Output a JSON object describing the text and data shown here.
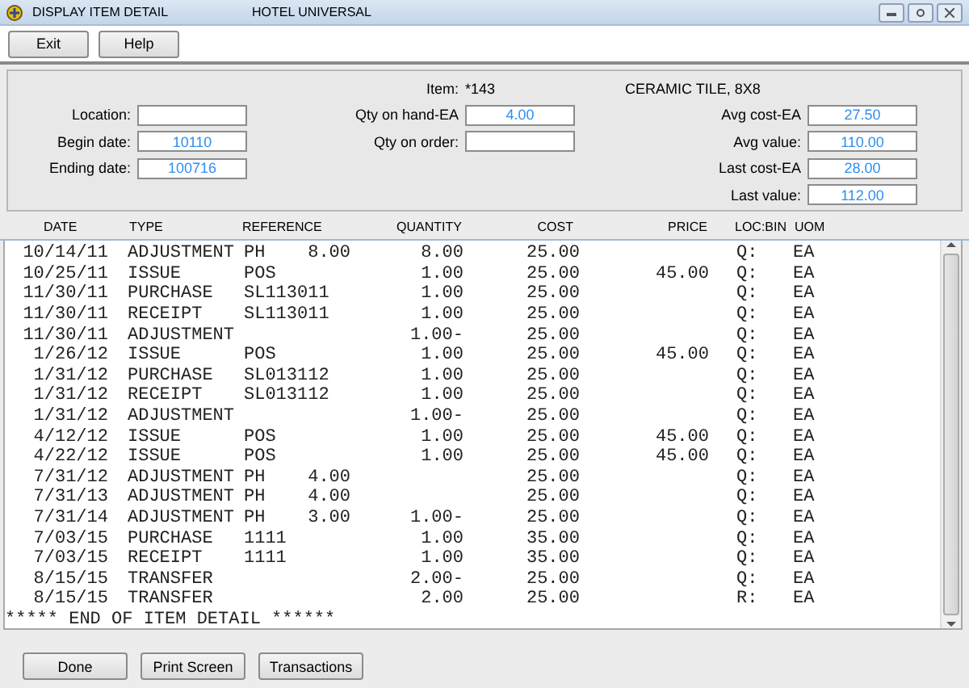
{
  "window": {
    "title": "DISPLAY ITEM DETAIL",
    "subtitle": "HOTEL UNIVERSAL"
  },
  "toolbar": [
    "Exit",
    "Help"
  ],
  "item": {
    "label": "Item:",
    "number": "*143",
    "description": "CERAMIC TILE, 8X8"
  },
  "left_fields": [
    {
      "label": "Location:"
    },
    {
      "label": "Begin date:",
      "value": "10110"
    },
    {
      "label": "Ending date:",
      "value": "100716"
    }
  ],
  "middle_fields": [
    {
      "label": "Qty on hand-EA",
      "value": "4.00"
    },
    {
      "label": "Qty on order:"
    }
  ],
  "right_fields": [
    {
      "label": "Avg cost-EA",
      "value": "27.50"
    },
    {
      "label": "Avg value:",
      "value": "110.00"
    },
    {
      "label": "Last cost-EA",
      "value": "28.00"
    },
    {
      "label": "Last value:",
      "value": "112.00"
    }
  ],
  "table": {
    "columns": [
      "DATE",
      "TYPE",
      "REFERENCE",
      "QUANTITY",
      "COST",
      "PRICE",
      "LOC:BIN",
      "UOM"
    ],
    "rows": [
      [
        "10/14/11",
        "ADJUSTMENT",
        "PH    8.00",
        "8.00",
        "25.00",
        "",
        "Q:",
        "EA"
      ],
      [
        "10/25/11",
        "ISSUE",
        "POS",
        "1.00",
        "25.00",
        "45.00",
        "Q:",
        "EA"
      ],
      [
        "11/30/11",
        "PURCHASE",
        "SL113011",
        "1.00",
        "25.00",
        "",
        "Q:",
        "EA"
      ],
      [
        "11/30/11",
        "RECEIPT",
        "SL113011",
        "1.00",
        "25.00",
        "",
        "Q:",
        "EA"
      ],
      [
        "11/30/11",
        "ADJUSTMENT",
        "",
        "1.00-",
        "25.00",
        "",
        "Q:",
        "EA"
      ],
      [
        "1/26/12",
        "ISSUE",
        "POS",
        "1.00",
        "25.00",
        "45.00",
        "Q:",
        "EA"
      ],
      [
        "1/31/12",
        "PURCHASE",
        "SL013112",
        "1.00",
        "25.00",
        "",
        "Q:",
        "EA"
      ],
      [
        "1/31/12",
        "RECEIPT",
        "SL013112",
        "1.00",
        "25.00",
        "",
        "Q:",
        "EA"
      ],
      [
        "1/31/12",
        "ADJUSTMENT",
        "",
        "1.00-",
        "25.00",
        "",
        "Q:",
        "EA"
      ],
      [
        "4/12/12",
        "ISSUE",
        "POS",
        "1.00",
        "25.00",
        "45.00",
        "Q:",
        "EA"
      ],
      [
        "4/22/12",
        "ISSUE",
        "POS",
        "1.00",
        "25.00",
        "45.00",
        "Q:",
        "EA"
      ],
      [
        "7/31/12",
        "ADJUSTMENT",
        "PH    4.00",
        "",
        "25.00",
        "",
        "Q:",
        "EA"
      ],
      [
        "7/31/13",
        "ADJUSTMENT",
        "PH    4.00",
        "",
        "25.00",
        "",
        "Q:",
        "EA"
      ],
      [
        "7/31/14",
        "ADJUSTMENT",
        "PH    3.00",
        "1.00-",
        "25.00",
        "",
        "Q:",
        "EA"
      ],
      [
        "7/03/15",
        "PURCHASE",
        "1111",
        "1.00",
        "35.00",
        "",
        "Q:",
        "EA"
      ],
      [
        "7/03/15",
        "RECEIPT",
        "1111",
        "1.00",
        "35.00",
        "",
        "Q:",
        "EA"
      ],
      [
        "8/15/15",
        "TRANSFER",
        "",
        "2.00-",
        "25.00",
        "",
        "Q:",
        "EA"
      ],
      [
        "8/15/15",
        "TRANSFER",
        "",
        "2.00",
        "25.00",
        "",
        "R:",
        "EA"
      ]
    ],
    "end_note": "***** END OF ITEM DETAIL ******"
  },
  "buttons": [
    "Done",
    "Print Screen",
    "Transactions"
  ]
}
